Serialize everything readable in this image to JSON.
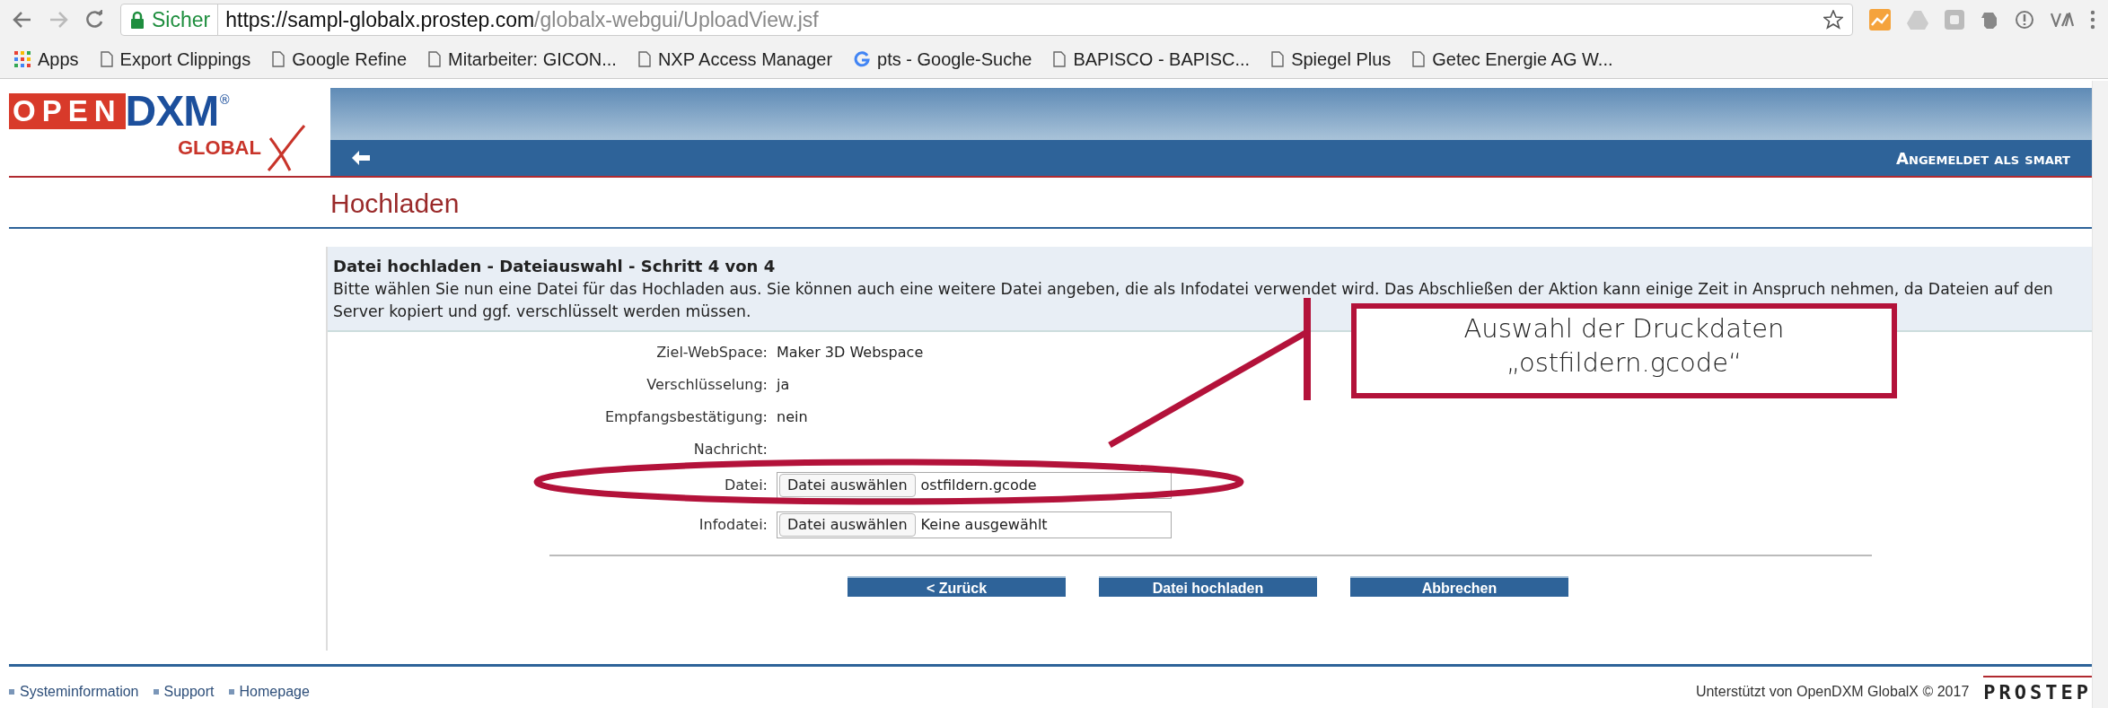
{
  "browser": {
    "secure_label": "Sicher",
    "url_host": "https://sampl-globalx.prostep.com",
    "url_path": "/globalx-webgui/UploadView.jsf",
    "bookmarks": [
      {
        "kind": "apps",
        "label": "Apps"
      },
      {
        "kind": "page",
        "label": "Export Clippings"
      },
      {
        "kind": "page",
        "label": "Google Refine"
      },
      {
        "kind": "page",
        "label": "Mitarbeiter: GICON..."
      },
      {
        "kind": "page",
        "label": "NXP Access Manager"
      },
      {
        "kind": "google",
        "label": "pts - Google-Suche"
      },
      {
        "kind": "page",
        "label": "BAPISCO - BAPISC..."
      },
      {
        "kind": "page",
        "label": "Spiegel Plus"
      },
      {
        "kind": "page",
        "label": "Getec Energie AG W..."
      }
    ]
  },
  "logo": {
    "open": "OPEN",
    "dxm": "DXM",
    "registered": "®",
    "global": "GLOBAL"
  },
  "header": {
    "user_label": "Angemeldet als smart"
  },
  "page_title": "Hochladen",
  "panel": {
    "title": "Datei hochladen - Dateiauswahl - Schritt 4 von 4",
    "description": "Bitte wählen Sie nun eine Datei für das Hochladen aus. Sie können auch eine weitere Datei angeben, die als Infodatei verwendet wird. Das Abschließen der Aktion kann einige Zeit in Anspruch nehmen, da Dateien auf den Server kopiert und ggf. verschlüsselt werden müssen.",
    "fields": [
      {
        "kind": "text",
        "label": "Ziel-WebSpace:",
        "value": "Maker 3D Webspace"
      },
      {
        "kind": "text",
        "label": "Verschlüsselung:",
        "value": "ja"
      },
      {
        "kind": "text",
        "label": "Empfangsbestätigung:",
        "value": "nein"
      },
      {
        "kind": "text",
        "label": "Nachricht:"
      },
      {
        "kind": "file",
        "label": "Datei:",
        "button": "Datei auswählen",
        "value": "ostfildern.gcode"
      },
      {
        "kind": "file",
        "label": "Infodatei:",
        "button": "Datei auswählen",
        "value": "Keine ausgewählt"
      }
    ],
    "buttons": [
      "< Zurück",
      "Datei hochladen",
      "Abbrechen"
    ]
  },
  "annotation": {
    "lines": [
      "Auswahl der Druckdaten",
      "„ostfildern.gcode“"
    ]
  },
  "footer": {
    "links": [
      "Systeminformation",
      "Support",
      "Homepage"
    ],
    "credit": "Unterstützt von OpenDXM GlobalX © 2017",
    "brand": "PROSTEP"
  }
}
